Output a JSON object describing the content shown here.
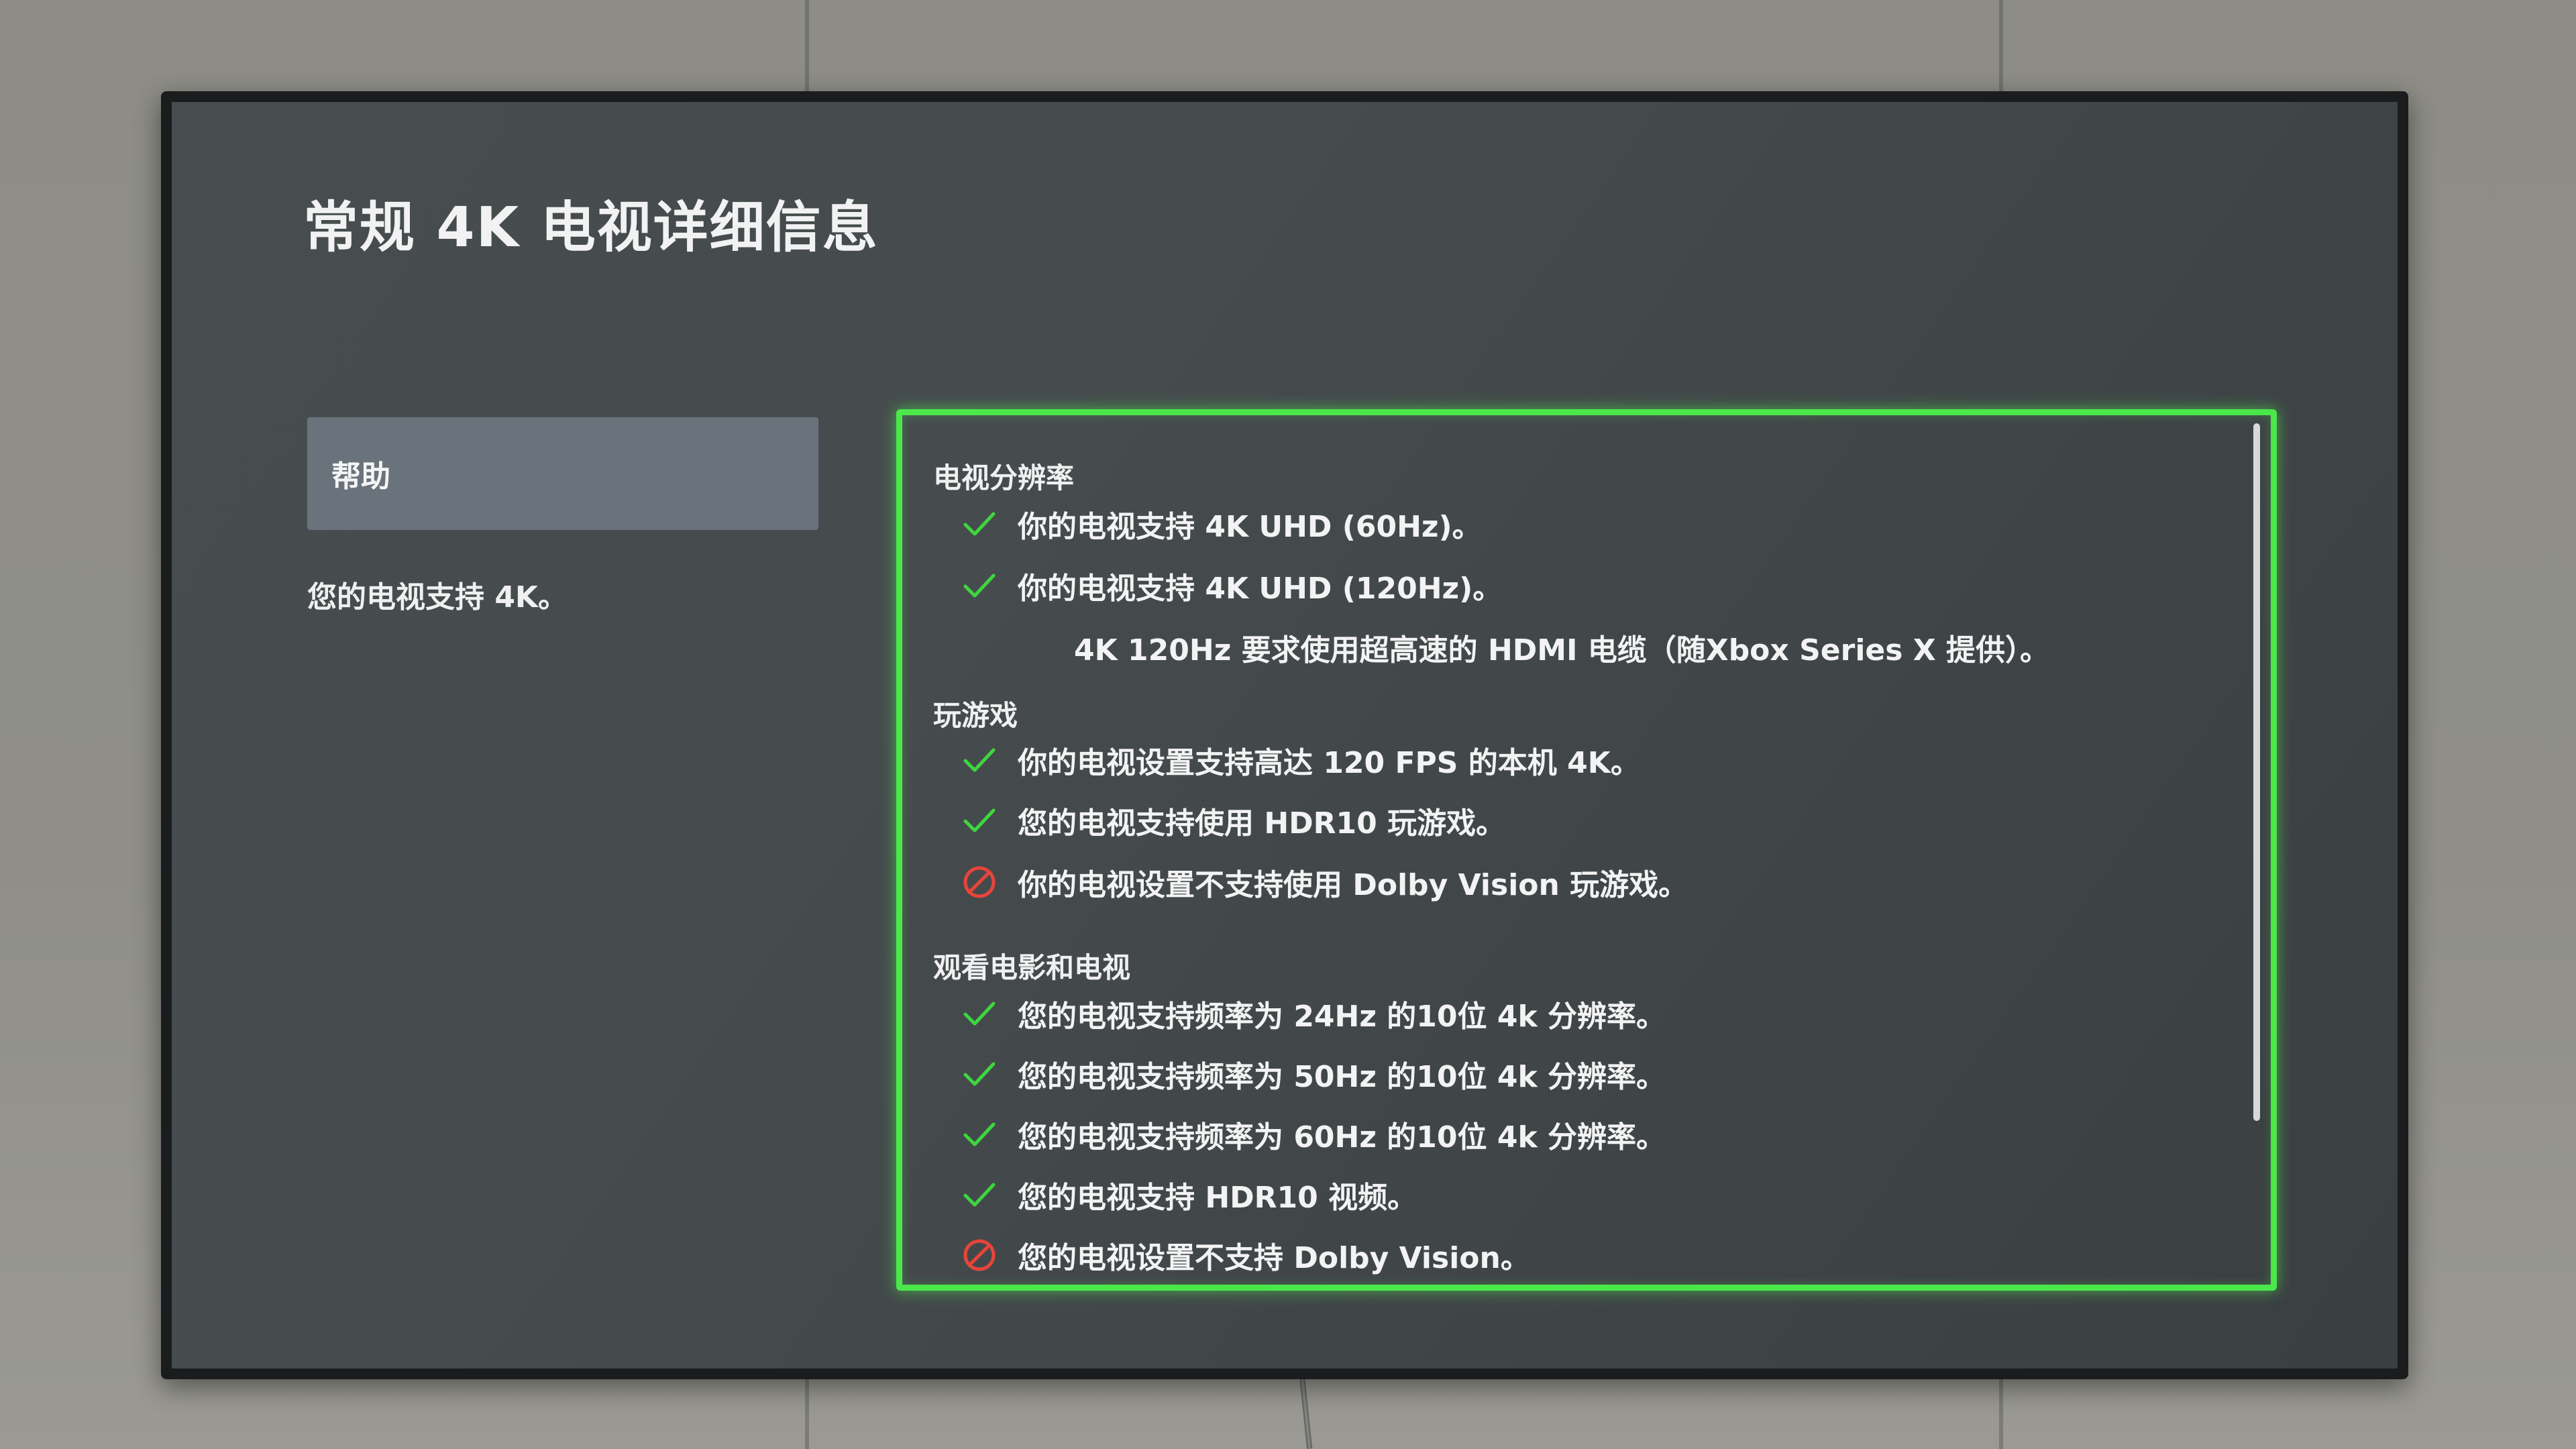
{
  "page": {
    "title": "常规 4K 电视详细信息"
  },
  "sidebar": {
    "help_label": "帮助",
    "summary": "您的电视支持 4K。"
  },
  "sections": [
    {
      "heading": "电视分辨率",
      "items": [
        {
          "status": "supported",
          "icon": "check-icon",
          "text": "你的电视支持 4K UHD (60Hz)。"
        },
        {
          "status": "supported",
          "icon": "check-icon",
          "text": "你的电视支持 4K UHD (120Hz)。"
        },
        {
          "status": "note",
          "text": "4K 120Hz 要求使用超高速的 HDMI 电缆（随Xbox Series X 提供）。"
        }
      ]
    },
    {
      "heading": "玩游戏",
      "items": [
        {
          "status": "supported",
          "icon": "check-icon",
          "text": "你的电视设置支持高达 120 FPS 的本机 4K。"
        },
        {
          "status": "supported",
          "icon": "check-icon",
          "text": "您的电视支持使用 HDR10 玩游戏。"
        },
        {
          "status": "unsupported",
          "icon": "blocked-icon",
          "text": "你的电视设置不支持使用 Dolby Vision 玩游戏。"
        }
      ]
    },
    {
      "heading": "观看电影和电视",
      "items": [
        {
          "status": "supported",
          "icon": "check-icon",
          "text": "您的电视支持频率为 24Hz 的10位 4k 分辨率。"
        },
        {
          "status": "supported",
          "icon": "check-icon",
          "text": "您的电视支持频率为 50Hz 的10位 4k 分辨率。"
        },
        {
          "status": "supported",
          "icon": "check-icon",
          "text": "您的电视支持频率为 60Hz 的10位 4k 分辨率。"
        },
        {
          "status": "supported",
          "icon": "check-icon",
          "text": "您的电视支持 HDR10 视频。"
        },
        {
          "status": "unsupported",
          "icon": "blocked-icon",
          "text": "您的电视设置不支持 Dolby Vision。"
        }
      ]
    }
  ],
  "colors": {
    "focus_border": "#4ae84a",
    "check": "#3ed63e",
    "blocked": "#e8443a",
    "help_button_bg": "#6a737b"
  }
}
